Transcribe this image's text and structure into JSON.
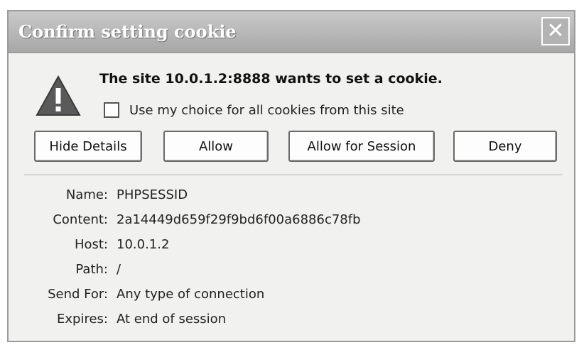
{
  "window": {
    "title": "Confirm setting cookie",
    "close_glyph": "✕"
  },
  "message": {
    "headline": "The site 10.0.1.2:8888 wants to set a cookie.",
    "checkbox_label": "Use my choice for all cookies from this site",
    "checkbox_checked": false
  },
  "buttons": {
    "hide_details": "Hide Details",
    "allow": "Allow",
    "allow_session": "Allow for Session",
    "deny": "Deny"
  },
  "details": [
    {
      "label": "Name:",
      "value": "PHPSESSID"
    },
    {
      "label": "Content:",
      "value": "2a14449d659f29f9bd6f00a6886c78fb"
    },
    {
      "label": "Host:",
      "value": "10.0.1.2"
    },
    {
      "label": "Path:",
      "value": "/"
    },
    {
      "label": "Send For:",
      "value": "Any type of connection"
    },
    {
      "label": "Expires:",
      "value": "At end of session"
    }
  ],
  "icons": {
    "warning": "warning-triangle-icon",
    "close": "close-icon"
  }
}
